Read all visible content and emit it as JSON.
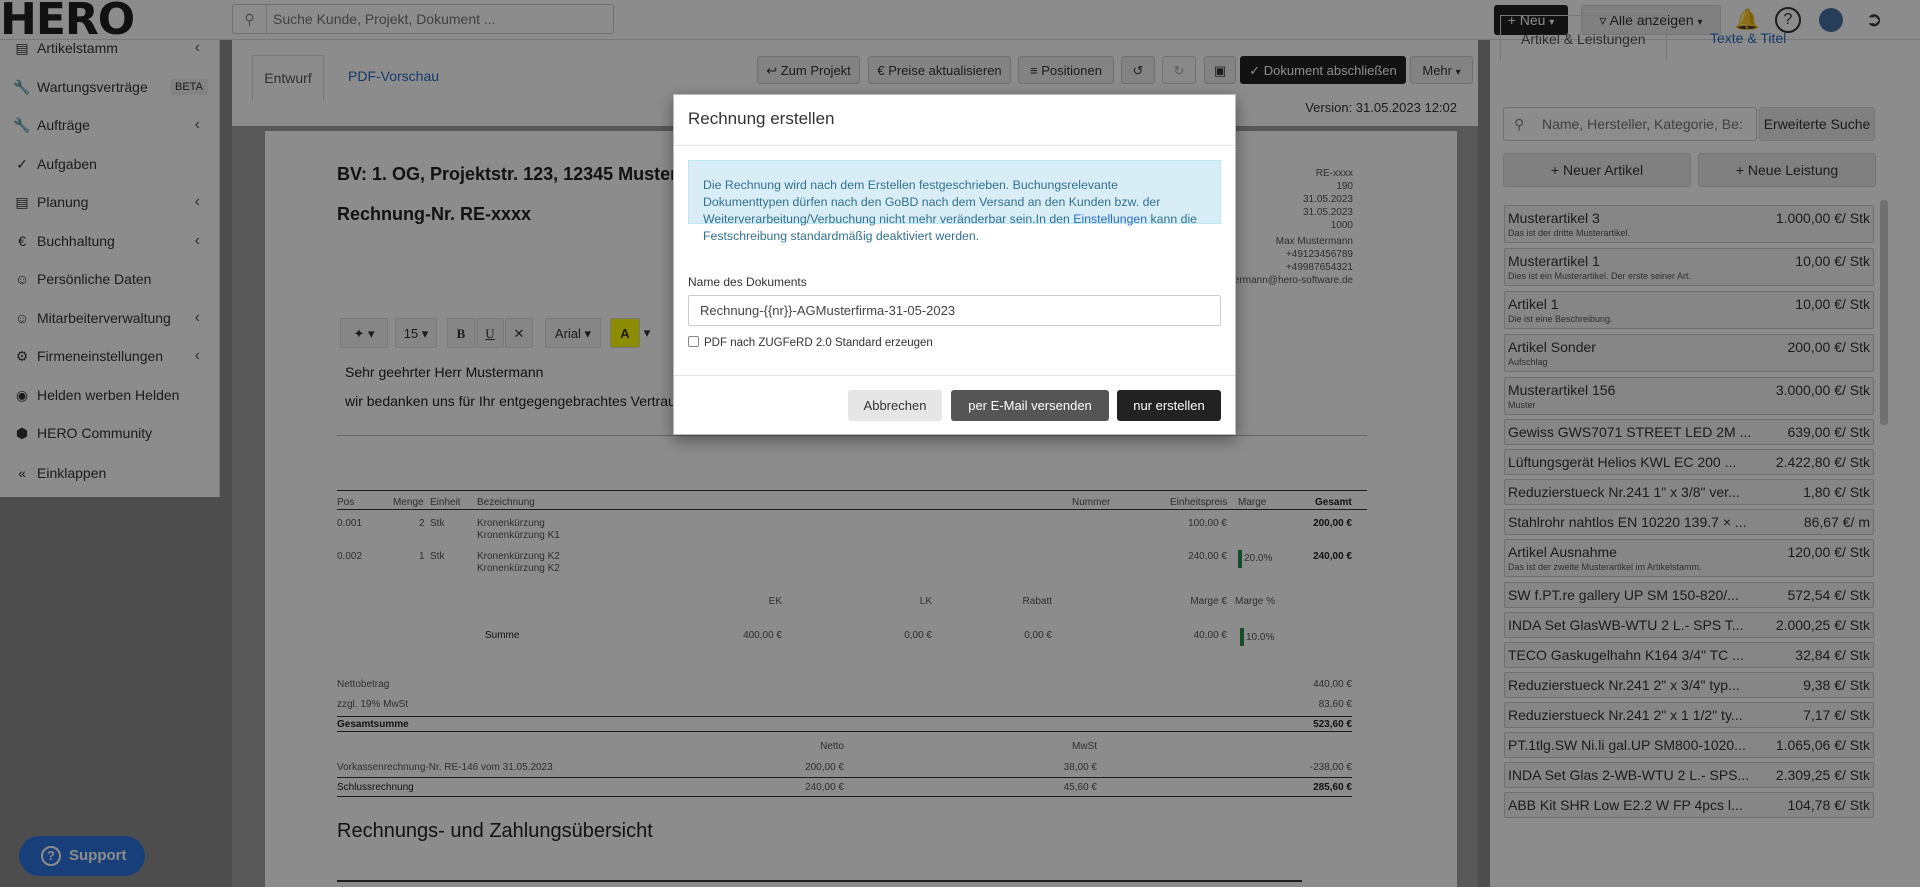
{
  "topbar": {
    "logo": "HERO",
    "search_placeholder": "Suche Kunde, Projekt, Dokument ...",
    "new_button": "+ Neu",
    "filter_button": "Alle anzeigen"
  },
  "sidebar": {
    "items": [
      {
        "label": "Artikelstamm",
        "icon": "list-icon"
      },
      {
        "label": "Wartungsverträge",
        "icon": "wrench-icon",
        "badge": "BETA"
      },
      {
        "label": "Aufträge",
        "icon": "wrench-icon"
      },
      {
        "label": "Aufgaben",
        "icon": "check-circle-icon"
      },
      {
        "label": "Planung",
        "icon": "calendar-icon"
      },
      {
        "label": "Buchhaltung",
        "icon": "euro-icon"
      },
      {
        "label": "Persönliche Daten",
        "icon": "user-icon"
      },
      {
        "label": "Mitarbeiterverwaltung",
        "icon": "users-icon"
      },
      {
        "label": "Firmeneinstellungen",
        "icon": "gear-icon"
      },
      {
        "label": "Helden werben Helden",
        "icon": "gift-icon"
      },
      {
        "label": "HERO Community",
        "icon": "hero-logo-icon"
      },
      {
        "label": "Einklappen",
        "icon": "double-chevron-left-icon"
      }
    ]
  },
  "document": {
    "tabs": [
      "Entwurf",
      "PDF-Vorschau"
    ],
    "toolbar": {
      "to_project": "Zum Projekt",
      "update_prices": "Preise aktualisieren",
      "positions": "Positionen",
      "finish": "Dokument abschließen",
      "more": "Mehr"
    },
    "version": "Version: 31.05.2023 12:02",
    "bv": "BV: 1. OG, Projektstr. 123, 12345 Musters",
    "number": "Rechnung-Nr. RE-xxxx",
    "meta": [
      "RE-xxxx",
      "190",
      "31.05.2023",
      "31.05.2023",
      "1000",
      "Max Mustermann",
      "+49123456789",
      "+49987654321",
      "maxmustermann@hero-software.de"
    ],
    "editor": {
      "font_size": "15",
      "font": "Arial"
    },
    "greeting": "Sehr geehrter Herr Mustermann",
    "thanks": "wir bedanken uns für Ihr entgegengebrachtes Vertrau",
    "table": {
      "headers": [
        "Pos",
        "Menge",
        "Einheit",
        "Bezeichnung",
        "Nummer",
        "Einheitspreis",
        "Marge",
        "Gesamt"
      ],
      "rows": [
        {
          "pos": "0.001",
          "qty": "2",
          "unit": "Stk",
          "desc1": "Kronenkürzung",
          "desc2": "Kronenkürzung K1",
          "price": "100,00 €",
          "margin": "",
          "total": "200,00 €"
        },
        {
          "pos": "0.002",
          "qty": "1",
          "unit": "Stk",
          "desc1": "Kronenkürzung K2",
          "desc2": "Kronenkürzung K2",
          "price": "240,00 €",
          "margin": "20.0%",
          "total": "240,00 €"
        }
      ]
    },
    "summary": {
      "headers": [
        "EK",
        "LK",
        "Rabatt",
        "Marge €",
        "Marge %"
      ],
      "label": "Summe",
      "values": [
        "400,00 €",
        "0,00 €",
        "0,00 €",
        "40,00 €",
        "10.0%"
      ]
    },
    "totals": [
      {
        "label": "Nettobetrag",
        "value": "440,00 €"
      },
      {
        "label": "zzgl. 19% MwSt",
        "value": "83,60 €"
      },
      {
        "label": "Gesamtsumme",
        "value": "523,60 €"
      }
    ],
    "advance": {
      "netto": "Netto",
      "mwst": "MwSt",
      "row1_label": "Vorkassenrechnung-Nr. RE-146 vom 31.05.2023",
      "row1": [
        "200,00 €",
        "38,00 €",
        "-238,00 €"
      ],
      "row2_label": "Schlussrechnung",
      "row2": [
        "240,00 €",
        "45,60 €",
        "285,60 €"
      ]
    },
    "overview_title": "Rechnungs- und Zahlungsübersicht"
  },
  "right_panel": {
    "tabs": [
      "Artikel & Leistungen",
      "Texte & Titel"
    ],
    "search_placeholder": "Name, Hersteller, Kategorie, Be:",
    "advanced_search": "Erweiterte Suche",
    "new_article": "Neuer Artikel",
    "new_service": "Neue Leistung",
    "articles": [
      {
        "name": "Musterartikel 3",
        "desc": "Das ist der dritte Musterartikel.",
        "price": "1.000,00 €/ Stk"
      },
      {
        "name": "Musterartikel 1",
        "desc": "Dies ist ein Musterartikel. Der erste seiner Art.",
        "price": "10,00 €/ Stk"
      },
      {
        "name": "Artikel 1",
        "desc": "Die ist eine Beschreibung.",
        "price": "10,00 €/ Stk"
      },
      {
        "name": "Artikel Sonder",
        "desc": "Aufschlag",
        "price": "200,00 €/ Stk"
      },
      {
        "name": "Musterartikel 156",
        "desc": "Muster",
        "price": "3.000,00 €/ Stk"
      },
      {
        "name": "Gewiss GWS7071 STREET LED 2M ...",
        "desc": "",
        "price": "639,00 €/ Stk"
      },
      {
        "name": "Lüftungsgerät Helios KWL EC 200 ...",
        "desc": "",
        "price": "2.422,80 €/ Stk"
      },
      {
        "name": "Reduzierstueck Nr.241 1\" x 3/8\" ver...",
        "desc": "",
        "price": "1,80 €/ Stk"
      },
      {
        "name": "Stahlrohr nahtlos EN 10220 139.7 × ...",
        "desc": "",
        "price": "86,67 €/ m"
      },
      {
        "name": "Artikel Ausnahme",
        "desc": "Das ist der zweite Musterartikel im Artikelstamm.",
        "price": "120,00 €/ Stk"
      },
      {
        "name": "SW f.PT.re gallery UP SM 150-820/...",
        "desc": "",
        "price": "572,54 €/ Stk"
      },
      {
        "name": "INDA Set GlasWB-WTU 2 L.- SPS T...",
        "desc": "",
        "price": "2.000,25 €/ Stk"
      },
      {
        "name": "TECO Gaskugelhahn K164 3/4\" TC ...",
        "desc": "",
        "price": "32,84 €/ Stk"
      },
      {
        "name": "Reduzierstueck Nr.241 2\" x 3/4\" typ...",
        "desc": "",
        "price": "9,38 €/ Stk"
      },
      {
        "name": "Reduzierstueck Nr.241 2\" x 1 1/2\" ty...",
        "desc": "",
        "price": "7,17 €/ Stk"
      },
      {
        "name": "PT.1tlg.SW Ni.li gal.UP SM800-1020...",
        "desc": "",
        "price": "1.065,06 €/ Stk"
      },
      {
        "name": "INDA Set Glas 2-WB-WTU 2 L.- SPS...",
        "desc": "",
        "price": "2.309,25 €/ Stk"
      },
      {
        "name": "ABB Kit SHR Low E2.2 W FP 4pcs l...",
        "desc": "",
        "price": "104,78 €/ Stk"
      }
    ]
  },
  "modal": {
    "title": "Rechnung erstellen",
    "info_text_1": "Die Rechnung wird nach dem Erstellen festgeschrieben. Buchungsrelevante Dokumenttypen dürfen nach den GoBD nach dem Versand an den Kunden bzw. der Weiterverarbeitung/Verbuchung nicht mehr veränderbar sein.In den ",
    "info_link": "Einstellungen",
    "info_text_2": " kann die Festschreibung standardmäßig deaktiviert werden.",
    "name_label": "Name des Dokuments",
    "name_value": "Rechnung-{{nr}}-AGMusterfirma-31-05-2023",
    "zugferd_label": "PDF nach ZUGFeRD 2.0 Standard erzeugen",
    "cancel": "Abbrechen",
    "email": "per E-Mail versenden",
    "create": "nur erstellen"
  },
  "support": {
    "label": "Support"
  },
  "colors": {
    "accent": "#2f74e0",
    "link": "#2a6bc4",
    "info_bg": "#d9edf7",
    "dark": "#222222"
  }
}
